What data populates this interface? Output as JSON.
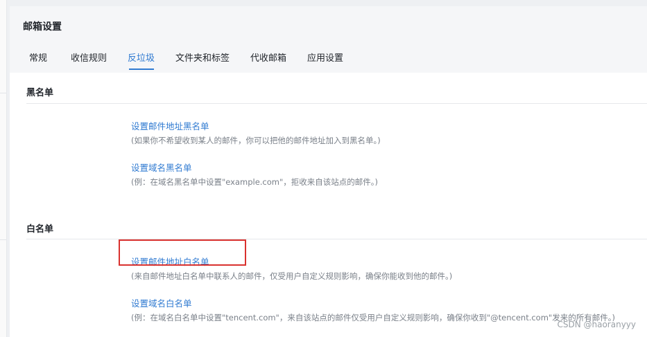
{
  "page": {
    "title": "邮箱设置"
  },
  "tabs": [
    {
      "label": "常规"
    },
    {
      "label": "收信规则"
    },
    {
      "label": "反垃圾"
    },
    {
      "label": "文件夹和标签"
    },
    {
      "label": "代收邮箱"
    },
    {
      "label": "应用设置"
    }
  ],
  "active_tab": "反垃圾",
  "blacklist": {
    "heading": "黑名单",
    "address_link": "设置邮件地址黑名单",
    "address_desc": "(如果你不希望收到某人的邮件，你可以把他的邮件地址加入到黑名单。)",
    "domain_link": "设置域名黑名单",
    "domain_desc": "(例：在域名黑名单中设置\"example.com\"，拒收来自该站点的邮件。)"
  },
  "whitelist": {
    "heading": "白名单",
    "address_link": "设置邮件地址白名单",
    "address_desc": "(来自邮件地址白名单中联系人的邮件，仅受用户自定义规则影响，确保你能收到他的邮件。)",
    "domain_link": "设置域名白名单",
    "domain_desc": "(例：在域名白名单中设置\"tencent.com\"，来自该站点的邮件仅受用户自定义规则影响，确保你收到\"@tencent.com\"发来的所有邮件。)"
  },
  "watermark": "CSDN @haoranyyy",
  "colors": {
    "accent": "#2f7ad1",
    "highlight": "#d9312e"
  }
}
